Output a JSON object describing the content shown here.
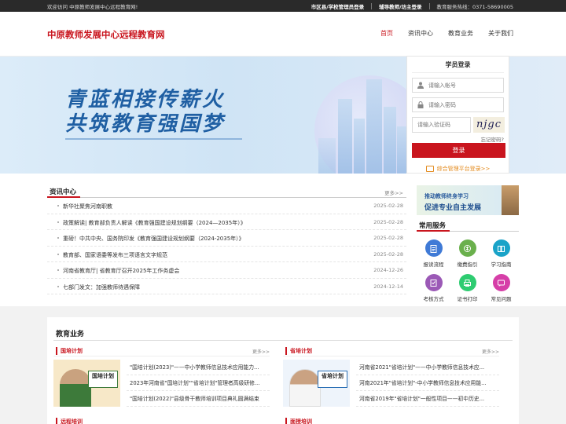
{
  "topbar": {
    "welcome": "欢迎访问 中原教师发展中心远程教育网!",
    "admin_login": "市区县/学校管理员登录",
    "tutor_login": "辅导教师/坊主登录",
    "hotline": "教育服务热线：0371-58690005"
  },
  "header": {
    "logo": "中原教师发展中心远程教育网",
    "nav": [
      "首页",
      "资讯中心",
      "教育业务",
      "关于我们"
    ]
  },
  "banner": {
    "line1": "青蓝相接传薪火",
    "line2": "共筑教育强国梦"
  },
  "login": {
    "title": "学员登录",
    "account_placeholder": "请输入帐号",
    "password_placeholder": "请输入密码",
    "captcha_placeholder": "请输入验证码",
    "captcha_text": "njgc",
    "forgot": "忘记密码?",
    "submit": "登录",
    "manager_link": "综合管理平台登录>>"
  },
  "news": {
    "title": "资讯中心",
    "more": "更多>>",
    "items": [
      {
        "text": "新华社聚焦河南职教",
        "date": "2025-02-28"
      },
      {
        "text": "政策解读| 教育部负责人解读《教育强国建设规划纲要（2024—2035年）》",
        "date": "2025-02-28"
      },
      {
        "text": "重磅！中共中央、国务院印发《教育强国建设规划纲要（2024-2035年）》",
        "date": "2025-02-28"
      },
      {
        "text": "教育部、国家语委等发布三项语言文字规范",
        "date": "2025-02-28"
      },
      {
        "text": "河南省教育厅| 省教育厅召开2025年工作务虚会",
        "date": "2024-12-26"
      },
      {
        "text": "七部门发文：加强教师待遇保障",
        "date": "2024-12-14"
      }
    ]
  },
  "promo": {
    "line1": "推动教师终身学习",
    "line2": "促进专业自主发展"
  },
  "services": {
    "title": "常用服务",
    "items": [
      {
        "label": "报读流程",
        "icon": "clipboard-icon",
        "color": "#3f7ad6"
      },
      {
        "label": "缴费指引",
        "icon": "payment-icon",
        "color": "#6ab04c"
      },
      {
        "label": "学习指南",
        "icon": "book-icon",
        "color": "#1aa3c8"
      },
      {
        "label": "考核方式",
        "icon": "exam-icon",
        "color": "#9b59b6"
      },
      {
        "label": "证书打印",
        "icon": "printer-icon",
        "color": "#2ecc71"
      },
      {
        "label": "常见问题",
        "icon": "question-icon",
        "color": "#d63fa8"
      }
    ]
  },
  "business": {
    "title": "教育业务",
    "left": {
      "title": "国培计划",
      "more": "更多>>",
      "badge": "国培计划",
      "items": [
        "\"国培计划(2023)\"——中小学教师信息技术应用能力...",
        "2023年河南省\"国培计划\"\"省培计划\"管理者高级研修...",
        "\"国培计划(2022)\"县级骨干教师培训项目典礼圆满结束"
      ],
      "next_title": "远程培训"
    },
    "right": {
      "title": "省培计划",
      "more": "更多>>",
      "badge": "省培计划",
      "items": [
        "河南省2021\"省培计划\"——中小学教师信息技术应...",
        "河南2021年\"省培计划\"-中小学教师信息技术应用能...",
        "河南省2019年\"省培计划\"一般性项目——初中历史..."
      ],
      "next_title": "面授培训"
    }
  },
  "colors": {
    "brand_red": "#c9151e",
    "banner_blue": "#1f5fa3",
    "accent_orange": "#e38b1f"
  }
}
